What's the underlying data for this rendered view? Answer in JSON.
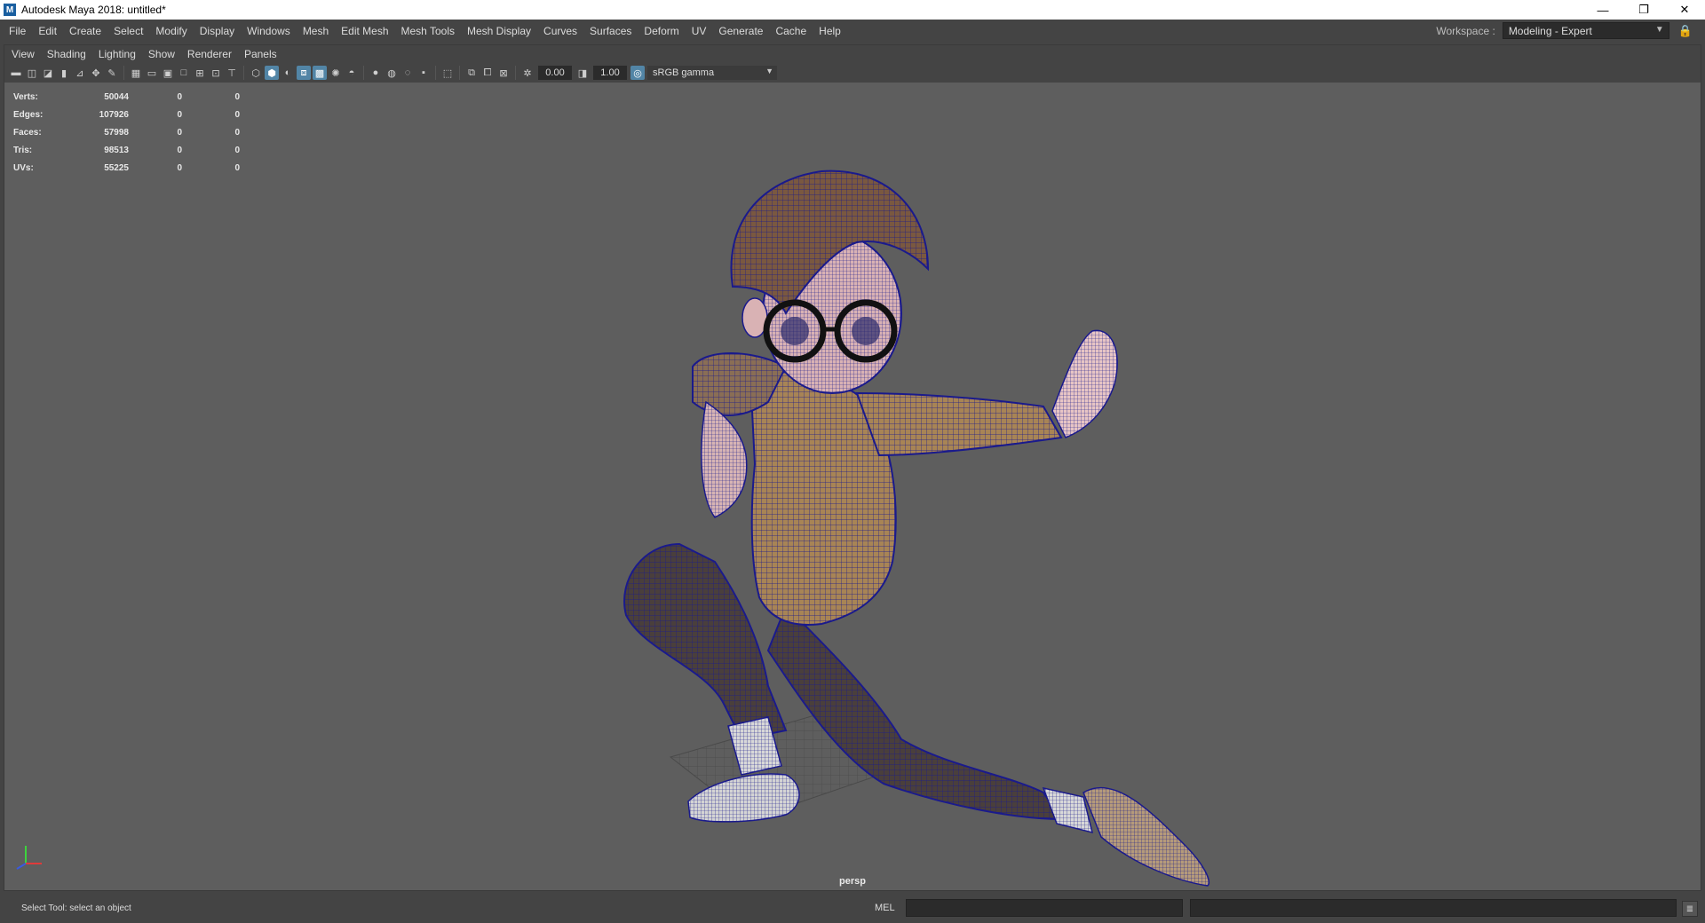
{
  "window": {
    "title": "Autodesk Maya 2018: untitled*",
    "app_icon_letter": "M",
    "minimize_glyph": "—",
    "restore_glyph": "❐",
    "close_glyph": "✕"
  },
  "menubar": {
    "items": [
      "File",
      "Edit",
      "Create",
      "Select",
      "Modify",
      "Display",
      "Windows",
      "Mesh",
      "Edit Mesh",
      "Mesh Tools",
      "Mesh Display",
      "Curves",
      "Surfaces",
      "Deform",
      "UV",
      "Generate",
      "Cache",
      "Help"
    ],
    "workspace_label": "Workspace :",
    "workspace_value": "Modeling - Expert"
  },
  "panel": {
    "menu": [
      "View",
      "Shading",
      "Lighting",
      "Show",
      "Renderer",
      "Panels"
    ],
    "toolbar": {
      "field_1": "0.00",
      "field_2": "1.00",
      "color_space": "sRGB gamma"
    }
  },
  "hud": {
    "rows": [
      {
        "label": "Verts:",
        "value": "50044",
        "sel": "0",
        "comp": "0"
      },
      {
        "label": "Edges:",
        "value": "107926",
        "sel": "0",
        "comp": "0"
      },
      {
        "label": "Faces:",
        "value": "57998",
        "sel": "0",
        "comp": "0"
      },
      {
        "label": "Tris:",
        "value": "98513",
        "sel": "0",
        "comp": "0"
      },
      {
        "label": "UVs:",
        "value": "55225",
        "sel": "0",
        "comp": "0"
      }
    ]
  },
  "viewport": {
    "camera": "persp",
    "background_color": "#5e5e5e",
    "wireframe_color": "#1a1a8c"
  },
  "status": {
    "help_line": "Select Tool: select an object",
    "command_language": "MEL"
  }
}
